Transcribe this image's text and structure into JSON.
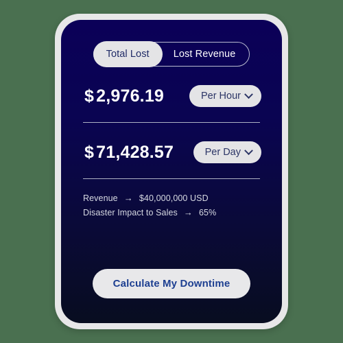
{
  "theme": {
    "page_background": "#4a7050",
    "card_frame": "#e7e7e8",
    "card_gradient_top": "#0b0058",
    "card_gradient_bottom": "#080d20",
    "pill_background": "#e4e4e6",
    "accent_text": "#1d3f91"
  },
  "toggle": {
    "active_label": "Total Lost",
    "inactive_label": "Lost Revenue"
  },
  "rows": [
    {
      "currency_symbol": "$",
      "amount": "2,976.19",
      "period_label": "Per Hour",
      "chevron": "chevron-down-icon"
    },
    {
      "currency_symbol": "$",
      "amount": "71,428.57",
      "period_label": "Per Day",
      "chevron": "chevron-down-icon"
    }
  ],
  "details": [
    {
      "label": "Revenue",
      "arrow": "→",
      "value": "$40,000,000 USD"
    },
    {
      "label": "Disaster Impact to Sales",
      "arrow": "→",
      "value": "65%"
    }
  ],
  "cta": {
    "label": "Calculate My Downtime"
  }
}
